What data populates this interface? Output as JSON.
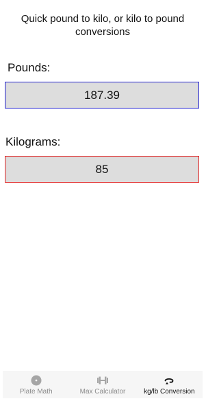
{
  "intro": {
    "text": "Quick pound to kilo, or kilo to pound\nconversions"
  },
  "pounds": {
    "label": "Pounds:",
    "value": "187.39"
  },
  "kilograms": {
    "label": "Kilograms:",
    "value": "85"
  },
  "colors": {
    "pounds_border": "#1f1fd0",
    "kilograms_border": "#e02020",
    "field_background": "#dddddd",
    "tab_inactive": "#8a8a8a",
    "tab_active": "#111111"
  },
  "tabs": [
    {
      "label": "Plate Math",
      "icon": "plate-icon",
      "active": false
    },
    {
      "label": "Max Calculator",
      "icon": "dumbbell-icon",
      "active": false
    },
    {
      "label": "kg/lb Conversion",
      "icon": "conversion-icon",
      "active": true
    }
  ]
}
